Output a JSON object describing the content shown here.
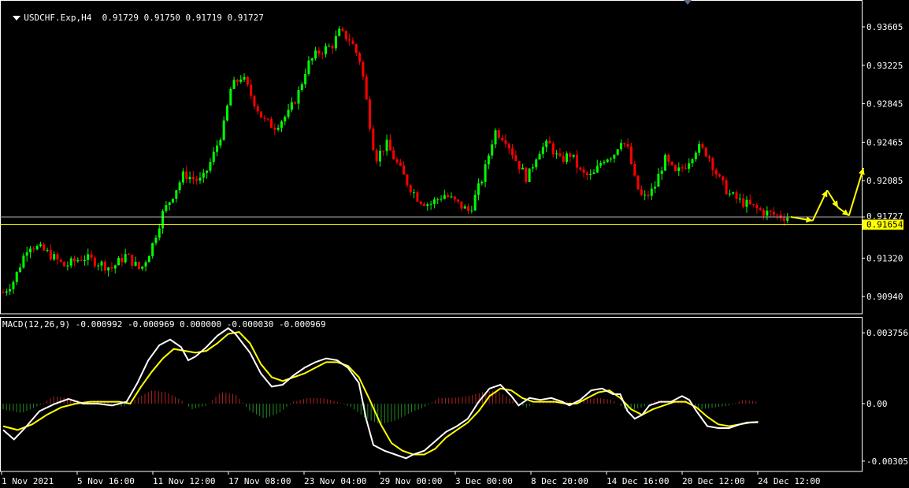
{
  "header": {
    "symbol": "USDCHF.Exp,H4",
    "ohlc": "0.91729 0.91750 0.91719 0.91727"
  },
  "macd_header": "MACD(12,26,9) -0.000992 -0.000969 0.000000 -0.000030 -0.000969",
  "colors": {
    "background": "#000000",
    "bull": "#00ff00",
    "bear": "#ff0000",
    "axis": "#ffffff",
    "price_line": "#c0c0c0",
    "support_line": "#ffff00",
    "macd_main": "#ffffff",
    "macd_signal": "#ffff00",
    "hist_pos": "#b22222",
    "hist_neg": "#228b22",
    "forecast_arrow": "#ffff00"
  },
  "chart_data": [
    {
      "type": "candlestick",
      "title": "USDCHF.Exp,H4",
      "y_ticks": [
        0.93605,
        0.93225,
        0.92845,
        0.92465,
        0.92085,
        0.91727,
        0.9132,
        0.9094
      ],
      "y_tick_labels": [
        "0.93605",
        "0.93225",
        "0.92845",
        "0.92465",
        "0.92085",
        "0.91727",
        "0.91320",
        "0.90940"
      ],
      "ylim": [
        0.9077,
        0.9387
      ],
      "current_price": 0.91727,
      "current_price_label": "0.91727",
      "support_level": 0.91654,
      "support_label": "0.91654",
      "x_labels": [
        "1 Nov 2021",
        "5 Nov 16:00",
        "11 Nov 12:00",
        "17 Nov 08:00",
        "23 Nov 04:00",
        "29 Nov 00:00",
        "3 Dec 00:00",
        "8 Dec 20:00",
        "14 Dec 16:00",
        "20 Dec 12:00",
        "24 Dec 12:00"
      ],
      "close_path": [
        [
          0,
          0.9098
        ],
        [
          3,
          0.911
        ],
        [
          7,
          0.9146
        ],
        [
          12,
          0.9138
        ],
        [
          17,
          0.9124
        ],
        [
          22,
          0.9133
        ],
        [
          26,
          0.9128
        ],
        [
          30,
          0.9122
        ],
        [
          34,
          0.9135
        ],
        [
          38,
          0.912
        ],
        [
          41,
          0.9142
        ],
        [
          44,
          0.9175
        ],
        [
          47,
          0.9195
        ],
        [
          50,
          0.9215
        ],
        [
          53,
          0.921
        ],
        [
          55,
          0.9208
        ],
        [
          58,
          0.9232
        ],
        [
          61,
          0.9262
        ],
        [
          63,
          0.93
        ],
        [
          66,
          0.9312
        ],
        [
          69,
          0.929
        ],
        [
          72,
          0.9268
        ],
        [
          75,
          0.9262
        ],
        [
          79,
          0.9275
        ],
        [
          82,
          0.9298
        ],
        [
          84,
          0.9322
        ],
        [
          87,
          0.9335
        ],
        [
          91,
          0.9342
        ],
        [
          93,
          0.9355
        ],
        [
          96,
          0.9348
        ],
        [
          99,
          0.9325
        ],
        [
          101,
          0.9275
        ],
        [
          103,
          0.923
        ],
        [
          106,
          0.9245
        ],
        [
          109,
          0.9225
        ],
        [
          112,
          0.9205
        ],
        [
          115,
          0.919
        ],
        [
          118,
          0.9185
        ],
        [
          122,
          0.9195
        ],
        [
          126,
          0.9185
        ],
        [
          129,
          0.9178
        ],
        [
          133,
          0.9215
        ],
        [
          136,
          0.9258
        ],
        [
          139,
          0.925
        ],
        [
          142,
          0.9228
        ],
        [
          145,
          0.921
        ],
        [
          148,
          0.9238
        ],
        [
          151,
          0.9245
        ],
        [
          154,
          0.9228
        ],
        [
          157,
          0.9235
        ],
        [
          160,
          0.9215
        ],
        [
          163,
          0.9212
        ],
        [
          166,
          0.923
        ],
        [
          169,
          0.9235
        ],
        [
          171,
          0.925
        ],
        [
          173,
          0.9238
        ],
        [
          175,
          0.9205
        ],
        [
          177,
          0.919
        ],
        [
          180,
          0.92
        ],
        [
          183,
          0.923
        ],
        [
          186,
          0.9215
        ],
        [
          189,
          0.9225
        ],
        [
          192,
          0.9242
        ],
        [
          195,
          0.9235
        ],
        [
          198,
          0.921
        ],
        [
          201,
          0.9195
        ],
        [
          204,
          0.9188
        ],
        [
          207,
          0.9183
        ],
        [
          210,
          0.9178
        ],
        [
          213,
          0.9175
        ],
        [
          216,
          0.9173
        ],
        [
          217,
          0.91727
        ]
      ],
      "forecast": [
        [
          217,
          0.91727
        ],
        [
          223,
          0.9169
        ],
        [
          227,
          0.9199
        ],
        [
          230,
          0.9182
        ],
        [
          233,
          0.9174
        ],
        [
          237,
          0.9221
        ]
      ]
    },
    {
      "type": "line",
      "title": "MACD(12,26,9)",
      "y_ticks": [
        0.003756,
        0.0,
        -0.00305
      ],
      "y_tick_labels": [
        "0.003756",
        "0.00",
        "-0.00305"
      ],
      "ylim": [
        -0.0036,
        0.0046
      ],
      "series": [
        {
          "name": "MACD",
          "points": [
            [
              0,
              -0.0014
            ],
            [
              3,
              -0.0019
            ],
            [
              6,
              -0.0013
            ],
            [
              10,
              -0.0004
            ],
            [
              14,
              -3e-05
            ],
            [
              18,
              0.00025
            ],
            [
              22,
              0.0
            ],
            [
              26,
              0.0
            ],
            [
              30,
              -0.0001
            ],
            [
              34,
              0.0001
            ],
            [
              37,
              0.0011
            ],
            [
              40,
              0.0023
            ],
            [
              43,
              0.0031
            ],
            [
              46,
              0.0034
            ],
            [
              49,
              0.003
            ],
            [
              51,
              0.0023
            ],
            [
              53,
              0.0025
            ],
            [
              56,
              0.003
            ],
            [
              59,
              0.0036
            ],
            [
              62,
              0.004
            ],
            [
              64,
              0.0037
            ],
            [
              66,
              0.0032
            ],
            [
              68,
              0.0027
            ],
            [
              71,
              0.0016
            ],
            [
              74,
              0.0009
            ],
            [
              77,
              0.001
            ],
            [
              80,
              0.0015
            ],
            [
              83,
              0.0019
            ],
            [
              86,
              0.0022
            ],
            [
              89,
              0.0024
            ],
            [
              92,
              0.0023
            ],
            [
              95,
              0.0019
            ],
            [
              98,
              0.0011
            ],
            [
              100,
              -0.0008
            ],
            [
              102,
              -0.0022
            ],
            [
              105,
              -0.0025
            ],
            [
              108,
              -0.0027
            ],
            [
              111,
              -0.0029
            ],
            [
              113,
              -0.0027
            ],
            [
              116,
              -0.0025
            ],
            [
              119,
              -0.002
            ],
            [
              122,
              -0.0015
            ],
            [
              125,
              -0.0012
            ],
            [
              128,
              -0.0008
            ],
            [
              131,
              0.0001
            ],
            [
              134,
              0.0008
            ],
            [
              137,
              0.001
            ],
            [
              140,
              0.0004
            ],
            [
              142,
              -0.0001
            ],
            [
              145,
              0.0003
            ],
            [
              148,
              0.0002
            ],
            [
              151,
              0.0003
            ],
            [
              154,
              0.0001
            ],
            [
              156,
              -0.0001
            ],
            [
              159,
              0.0002
            ],
            [
              162,
              0.0007
            ],
            [
              165,
              0.0008
            ],
            [
              168,
              0.0005
            ],
            [
              170,
              0.0005
            ],
            [
              172,
              -0.0004
            ],
            [
              174,
              -0.0008
            ],
            [
              176,
              -0.0006
            ],
            [
              178,
              -0.0001
            ],
            [
              181,
              0.0001
            ],
            [
              184,
              0.0001
            ],
            [
              187,
              0.0004
            ],
            [
              189,
              0.0002
            ],
            [
              191,
              -0.0004
            ],
            [
              194,
              -0.0012
            ],
            [
              197,
              -0.0013
            ],
            [
              200,
              -0.0013
            ],
            [
              203,
              -0.0011
            ],
            [
              205,
              -0.001
            ],
            [
              208,
              -0.00099
            ]
          ]
        },
        {
          "name": "Signal",
          "points": [
            [
              0,
              -0.0012
            ],
            [
              4,
              -0.0014
            ],
            [
              8,
              -0.0011
            ],
            [
              12,
              -0.0006
            ],
            [
              16,
              -0.0002
            ],
            [
              20,
              0.0
            ],
            [
              24,
              0.0001
            ],
            [
              28,
              0.0001
            ],
            [
              32,
              0.0001
            ],
            [
              35,
              0.0
            ],
            [
              38,
              0.0009
            ],
            [
              41,
              0.0017
            ],
            [
              44,
              0.0024
            ],
            [
              47,
              0.0029
            ],
            [
              50,
              0.0028
            ],
            [
              53,
              0.0027
            ],
            [
              56,
              0.0028
            ],
            [
              59,
              0.0032
            ],
            [
              62,
              0.0037
            ],
            [
              65,
              0.0038
            ],
            [
              68,
              0.0032
            ],
            [
              71,
              0.0021
            ],
            [
              74,
              0.0014
            ],
            [
              77,
              0.0012
            ],
            [
              80,
              0.0014
            ],
            [
              83,
              0.0016
            ],
            [
              86,
              0.0019
            ],
            [
              89,
              0.0022
            ],
            [
              92,
              0.0022
            ],
            [
              95,
              0.002
            ],
            [
              98,
              0.0014
            ],
            [
              101,
              0.0002
            ],
            [
              104,
              -0.0011
            ],
            [
              107,
              -0.0021
            ],
            [
              110,
              -0.0025
            ],
            [
              113,
              -0.0027
            ],
            [
              116,
              -0.0027
            ],
            [
              119,
              -0.0024
            ],
            [
              122,
              -0.0018
            ],
            [
              125,
              -0.0014
            ],
            [
              128,
              -0.001
            ],
            [
              131,
              -0.0004
            ],
            [
              134,
              0.0004
            ],
            [
              137,
              0.0008
            ],
            [
              140,
              0.0007
            ],
            [
              143,
              0.0003
            ],
            [
              146,
              0.0001
            ],
            [
              149,
              0.0001
            ],
            [
              152,
              0.0001
            ],
            [
              155,
              0.0
            ],
            [
              158,
              0.0
            ],
            [
              161,
              0.0003
            ],
            [
              164,
              0.0006
            ],
            [
              167,
              0.0007
            ],
            [
              170,
              0.0003
            ],
            [
              173,
              -0.0003
            ],
            [
              176,
              -0.0006
            ],
            [
              179,
              -0.0003
            ],
            [
              182,
              -0.0001
            ],
            [
              185,
              0.0001
            ],
            [
              188,
              0.0001
            ],
            [
              191,
              -0.0002
            ],
            [
              194,
              -0.0007
            ],
            [
              197,
              -0.0011
            ],
            [
              200,
              -0.0012
            ],
            [
              203,
              -0.0011
            ],
            [
              206,
              -0.001
            ],
            [
              208,
              -0.00097
            ]
          ]
        },
        {
          "name": "Histogram",
          "points": [
            [
              0,
              -0.0003
            ],
            [
              5,
              -0.0005
            ],
            [
              10,
              -0.0001
            ],
            [
              14,
              0.0004
            ],
            [
              18,
              0.0003
            ],
            [
              22,
              0.0001
            ],
            [
              26,
              0.0002
            ],
            [
              29,
              0.0001
            ],
            [
              33,
              -0.0002
            ],
            [
              37,
              0.0003
            ],
            [
              41,
              0.0007
            ],
            [
              45,
              0.0006
            ],
            [
              49,
              0.0002
            ],
            [
              52,
              -0.0003
            ],
            [
              56,
              -0.0001
            ],
            [
              60,
              0.0006
            ],
            [
              64,
              0.0005
            ],
            [
              68,
              -0.0004
            ],
            [
              72,
              -0.0008
            ],
            [
              76,
              -0.0005
            ],
            [
              80,
              0.0001
            ],
            [
              84,
              0.0003
            ],
            [
              88,
              0.0003
            ],
            [
              92,
              0.0001
            ],
            [
              96,
              -0.0002
            ],
            [
              100,
              -0.0008
            ],
            [
              104,
              -0.0011
            ],
            [
              108,
              -0.0009
            ],
            [
              112,
              -0.0005
            ],
            [
              116,
              -0.0002
            ],
            [
              120,
              0.0003
            ],
            [
              124,
              0.0003
            ],
            [
              128,
              0.0004
            ],
            [
              132,
              0.0006
            ],
            [
              136,
              0.0007
            ],
            [
              140,
              0.0002
            ],
            [
              144,
              -0.0002
            ],
            [
              148,
              0.0001
            ],
            [
              152,
              0.0002
            ],
            [
              156,
              0.0001
            ],
            [
              160,
              0.0002
            ],
            [
              164,
              0.0003
            ],
            [
              168,
              0.0002
            ],
            [
              172,
              -0.0004
            ],
            [
              176,
              -0.0002
            ],
            [
              180,
              0.0002
            ],
            [
              184,
              0.0001
            ],
            [
              188,
              0.0002
            ],
            [
              192,
              -0.0003
            ],
            [
              196,
              -0.0002
            ],
            [
              200,
              -0.0001
            ],
            [
              204,
              0.0002
            ],
            [
              208,
              0.0001
            ]
          ]
        }
      ]
    }
  ]
}
